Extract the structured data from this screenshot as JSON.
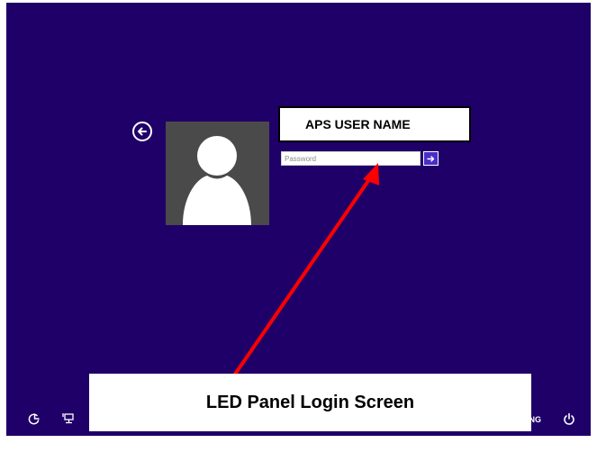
{
  "login": {
    "back_icon": "arrow-left-circle-icon",
    "avatar_icon": "user-silhouette-icon",
    "username_label": "APS USER NAME",
    "password_placeholder": "Password",
    "password_value": "",
    "submit_icon": "arrow-right-icon"
  },
  "caption": {
    "text": "LED Panel Login Screen"
  },
  "taskbar": {
    "ease_of_access_icon": "ease-of-access-icon",
    "network_icon": "network-icon",
    "language_partial": "ENG",
    "power_icon": "power-icon"
  },
  "colors": {
    "background": "#1f0068",
    "avatar_bg": "#4a4a4a",
    "submit_bg": "#4a2cc8",
    "arrow": "#ff0000"
  }
}
